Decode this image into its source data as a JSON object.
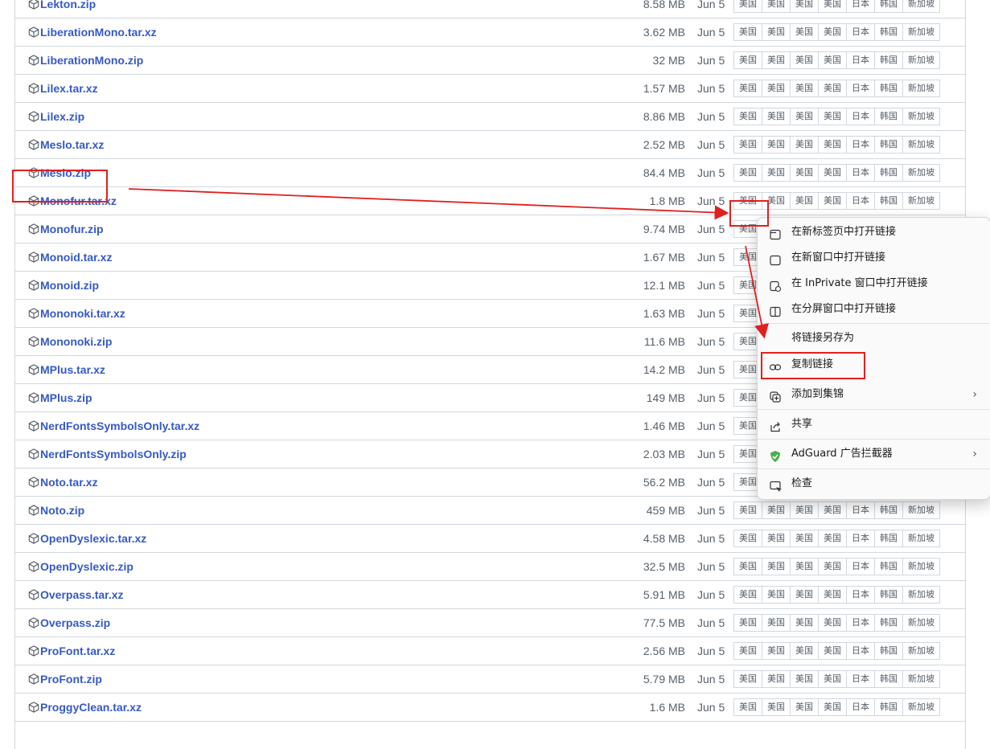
{
  "files": [
    {
      "name": "Lekton.zip",
      "size": "8.58 MB",
      "date": "Jun 5"
    },
    {
      "name": "LiberationMono.tar.xz",
      "size": "3.62 MB",
      "date": "Jun 5"
    },
    {
      "name": "LiberationMono.zip",
      "size": "32 MB",
      "date": "Jun 5"
    },
    {
      "name": "Lilex.tar.xz",
      "size": "1.57 MB",
      "date": "Jun 5"
    },
    {
      "name": "Lilex.zip",
      "size": "8.86 MB",
      "date": "Jun 5"
    },
    {
      "name": "Meslo.tar.xz",
      "size": "2.52 MB",
      "date": "Jun 5"
    },
    {
      "name": "Meslo.zip",
      "size": "84.4 MB",
      "date": "Jun 5"
    },
    {
      "name": "Monofur.tar.xz",
      "size": "1.8 MB",
      "date": "Jun 5"
    },
    {
      "name": "Monofur.zip",
      "size": "9.74 MB",
      "date": "Jun 5"
    },
    {
      "name": "Monoid.tar.xz",
      "size": "1.67 MB",
      "date": "Jun 5"
    },
    {
      "name": "Monoid.zip",
      "size": "12.1 MB",
      "date": "Jun 5"
    },
    {
      "name": "Mononoki.tar.xz",
      "size": "1.63 MB",
      "date": "Jun 5"
    },
    {
      "name": "Mononoki.zip",
      "size": "11.6 MB",
      "date": "Jun 5"
    },
    {
      "name": "MPlus.tar.xz",
      "size": "14.2 MB",
      "date": "Jun 5"
    },
    {
      "name": "MPlus.zip",
      "size": "149 MB",
      "date": "Jun 5"
    },
    {
      "name": "NerdFontsSymbolsOnly.tar.xz",
      "size": "1.46 MB",
      "date": "Jun 5"
    },
    {
      "name": "NerdFontsSymbolsOnly.zip",
      "size": "2.03 MB",
      "date": "Jun 5"
    },
    {
      "name": "Noto.tar.xz",
      "size": "56.2 MB",
      "date": "Jun 5"
    },
    {
      "name": "Noto.zip",
      "size": "459 MB",
      "date": "Jun 5"
    },
    {
      "name": "OpenDyslexic.tar.xz",
      "size": "4.58 MB",
      "date": "Jun 5"
    },
    {
      "name": "OpenDyslexic.zip",
      "size": "32.5 MB",
      "date": "Jun 5"
    },
    {
      "name": "Overpass.tar.xz",
      "size": "5.91 MB",
      "date": "Jun 5"
    },
    {
      "name": "Overpass.zip",
      "size": "77.5 MB",
      "date": "Jun 5"
    },
    {
      "name": "ProFont.tar.xz",
      "size": "2.56 MB",
      "date": "Jun 5"
    },
    {
      "name": "ProFont.zip",
      "size": "5.79 MB",
      "date": "Jun 5"
    },
    {
      "name": "ProggyClean.tar.xz",
      "size": "1.6 MB",
      "date": "Jun 5"
    },
    {
      "name": "",
      "size": "",
      "date": ""
    }
  ],
  "mirrors": [
    "美国",
    "美国",
    "美国",
    "美国",
    "日本",
    "韩国",
    "新加坡"
  ],
  "context_menu": {
    "items": [
      {
        "label": "在新标签页中打开链接",
        "icon": "new-tab-icon"
      },
      {
        "label": "在新窗口中打开链接",
        "icon": "new-window-icon"
      },
      {
        "label": "在 InPrivate 窗口中打开链接",
        "icon": "inprivate-window-icon"
      },
      {
        "label": "在分屏窗口中打开链接",
        "icon": "split-screen-icon"
      },
      {
        "label": "将链接另存为",
        "icon": ""
      },
      {
        "label": "复制链接",
        "icon": "link-icon"
      },
      {
        "label": "添加到集锦",
        "icon": "collections-icon",
        "submenu": true
      },
      {
        "label": "共享",
        "icon": "share-icon"
      },
      {
        "label": "AdGuard 广告拦截器",
        "icon": "adguard-shield-icon",
        "submenu": true
      },
      {
        "label": "检查",
        "icon": "inspect-icon"
      }
    ]
  },
  "colors": {
    "link": "#3559c8",
    "annotation": "#e02020",
    "border": "#d0d7de",
    "adguard": "#4caf50"
  }
}
